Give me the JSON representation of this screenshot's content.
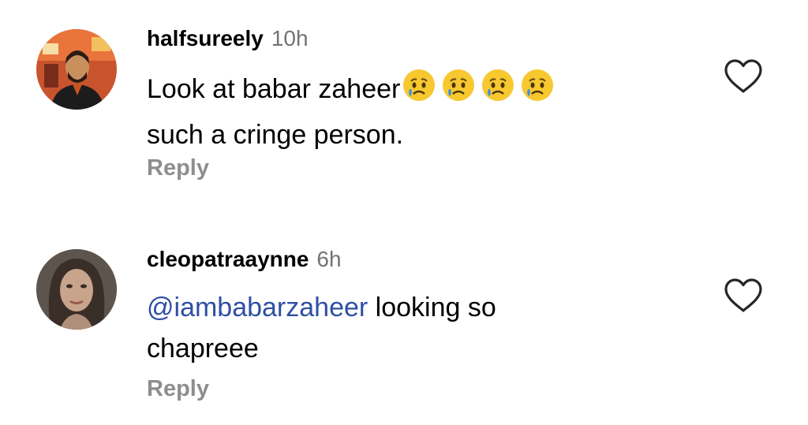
{
  "comments": [
    {
      "username": "halfsureely",
      "time": "10h",
      "text_line1": "Look at babar zaheer",
      "emojis": [
        "crying-face",
        "crying-face",
        "crying-face",
        "crying-face"
      ],
      "text_line2": "such a cringe person.",
      "reply_label": "Reply",
      "avatar": "profile-photo-man"
    },
    {
      "username": "cleopatraaynne",
      "time": "6h",
      "mention": "@iambabarzaheer",
      "text_after_mention": " looking so",
      "text_line2": "chapreee",
      "reply_label": "Reply",
      "avatar": "profile-photo-woman"
    }
  ],
  "icons": {
    "like": "heart-outline-icon"
  },
  "colors": {
    "timestamp": "#737373",
    "reply": "#8e8e8e",
    "mention": "#2f4fa3"
  }
}
